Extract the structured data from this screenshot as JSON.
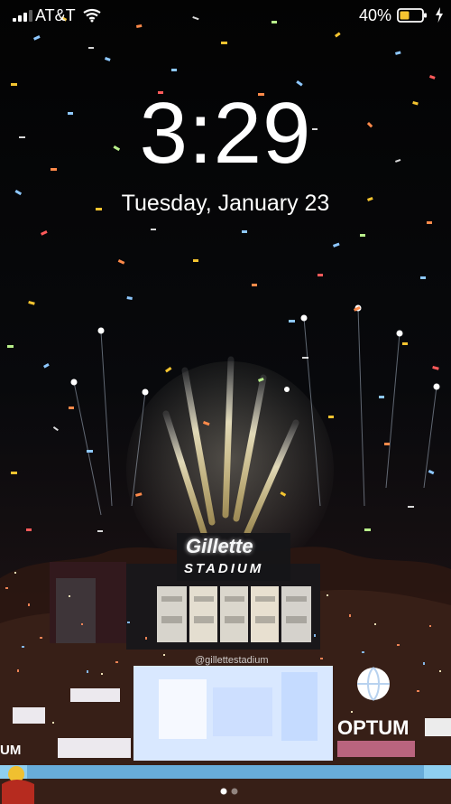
{
  "status_bar": {
    "carrier": "AT&T",
    "battery_percent": "40%",
    "battery_level": 0.4,
    "battery_color": "#f4c430",
    "signal_bars": 3,
    "icons": [
      "signal-icon",
      "wifi-icon",
      "battery-icon",
      "charging-bolt-icon"
    ]
  },
  "lock_screen": {
    "time": "3:29",
    "date": "Tuesday, January 23"
  },
  "wallpaper": {
    "scene": "stadium-fireworks",
    "signage": {
      "gillette": "Gillette",
      "stadium": "STADIUM",
      "handle": "@gillettestadium",
      "sponsor": "OPTUM",
      "corner_text": "UM"
    }
  },
  "page_indicator": {
    "pages": 2,
    "active": 1
  },
  "colors": {
    "background": "#050505",
    "text": "#ffffff",
    "confetti": [
      "#8ec8ff",
      "#f4c430",
      "#ff8a4a",
      "#ffffff",
      "#ff5a5a",
      "#b9f08b"
    ]
  }
}
